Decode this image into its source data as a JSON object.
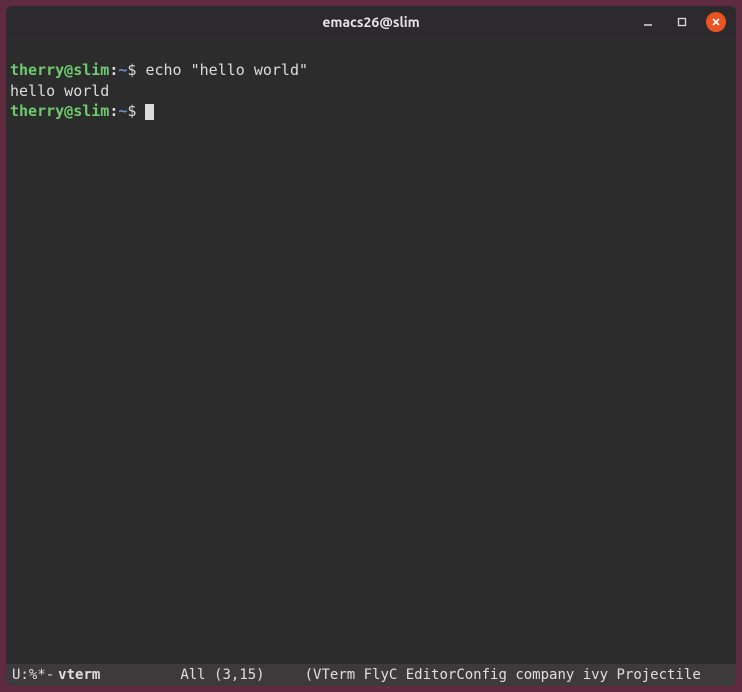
{
  "window": {
    "title": "emacs26@slim"
  },
  "prompt": {
    "user_host": "therry@slim",
    "separator": ":",
    "path": "~",
    "symbol": "$"
  },
  "lines": {
    "command": "echo \"hello world\"",
    "output": "hello world"
  },
  "modeline": {
    "status": "U:%*-",
    "buffer": "vterm",
    "position": "All (3,15)",
    "modes": "(VTerm FlyC EditorConfig company ivy Projectile"
  },
  "colors": {
    "bg": "#2c2c2c",
    "fg": "#dcdcdc",
    "user": "#6ecb6e",
    "path": "#6c8ed6",
    "close": "#e95420",
    "frame": "#5e2b3f"
  }
}
